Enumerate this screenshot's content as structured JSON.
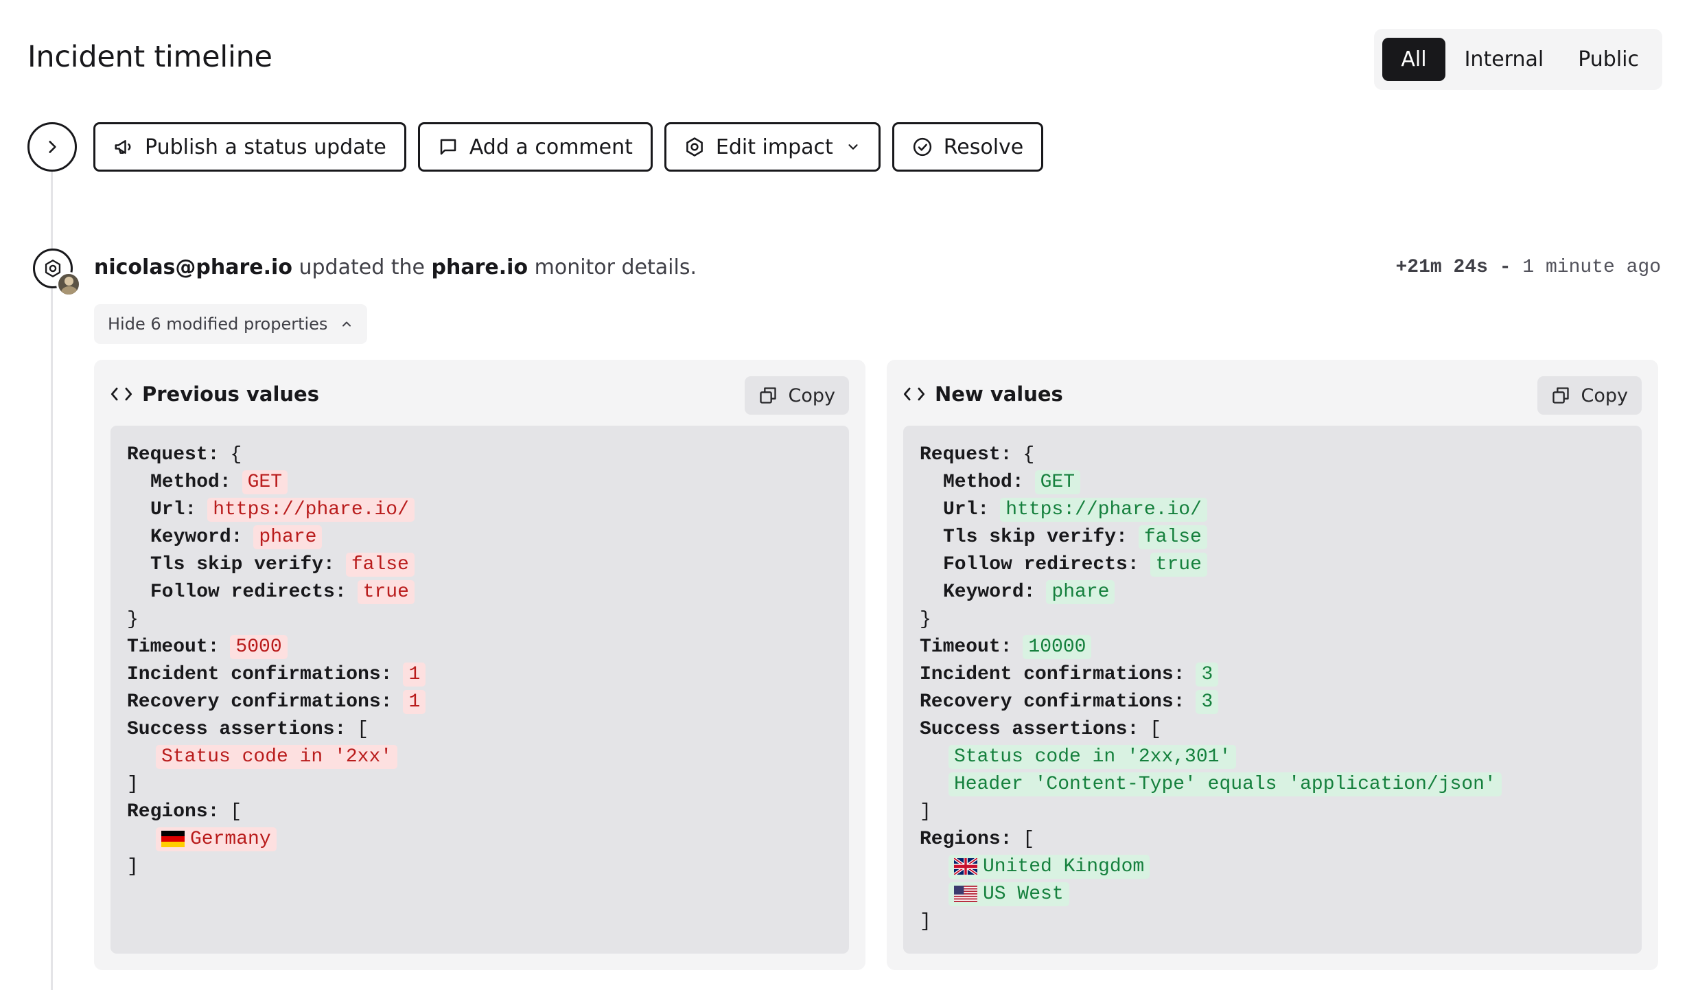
{
  "header": {
    "title": "Incident timeline",
    "filters": [
      {
        "label": "All",
        "active": true
      },
      {
        "label": "Internal",
        "active": false
      },
      {
        "label": "Public",
        "active": false
      }
    ]
  },
  "actions": {
    "publish": "Publish a status update",
    "comment": "Add a comment",
    "edit_impact": "Edit impact",
    "resolve": "Resolve"
  },
  "event": {
    "actor": "nicolas@phare.io",
    "verb": "updated the",
    "target": "phare.io",
    "suffix": "monitor details.",
    "offset": "+21m 24s",
    "separator": "-",
    "relative": "1 minute ago",
    "toggle_label": "Hide 6 modified properties"
  },
  "previous": {
    "title": "Previous values",
    "copy_label": "Copy",
    "request_label": "Request:",
    "open_brace": "{",
    "close_brace": "}",
    "method_key": "Method:",
    "method": "GET",
    "url_key": "Url:",
    "url": "https://phare.io/",
    "keyword_key": "Keyword:",
    "keyword": "phare",
    "tls_key": "Tls skip verify:",
    "tls": "false",
    "follow_key": "Follow redirects:",
    "follow": "true",
    "timeout_key": "Timeout:",
    "timeout": "5000",
    "incident_key": "Incident confirmations:",
    "incident": "1",
    "recovery_key": "Recovery confirmations:",
    "recovery": "1",
    "assertions_key": "Success assertions:",
    "open_bracket": "[",
    "close_bracket": "]",
    "assertions": [
      "Status code in '2xx'"
    ],
    "regions_key": "Regions:",
    "regions": [
      {
        "name": "Germany",
        "flag": "de-flag"
      }
    ]
  },
  "new": {
    "title": "New values",
    "copy_label": "Copy",
    "request_label": "Request:",
    "open_brace": "{",
    "close_brace": "}",
    "method_key": "Method:",
    "method": "GET",
    "url_key": "Url:",
    "url": "https://phare.io/",
    "tls_key": "Tls skip verify:",
    "tls": "false",
    "follow_key": "Follow redirects:",
    "follow": "true",
    "keyword_key": "Keyword:",
    "keyword": "phare",
    "timeout_key": "Timeout:",
    "timeout": "10000",
    "incident_key": "Incident confirmations:",
    "incident": "3",
    "recovery_key": "Recovery confirmations:",
    "recovery": "3",
    "assertions_key": "Success assertions:",
    "open_bracket": "[",
    "close_bracket": "]",
    "assertions": [
      "Status code in '2xx,301'",
      "Header 'Content-Type' equals 'application/json'"
    ],
    "regions_key": "Regions:",
    "regions": [
      {
        "name": "United Kingdom",
        "flag": "uk-flag"
      },
      {
        "name": "US West",
        "flag": "us-flag"
      }
    ]
  },
  "colors": {
    "removed_bg": "#fde0e0",
    "removed_text": "#b91c1c",
    "added_bg": "#d9f2e2",
    "added_text": "#15803d",
    "active_filter": "#18181b"
  }
}
